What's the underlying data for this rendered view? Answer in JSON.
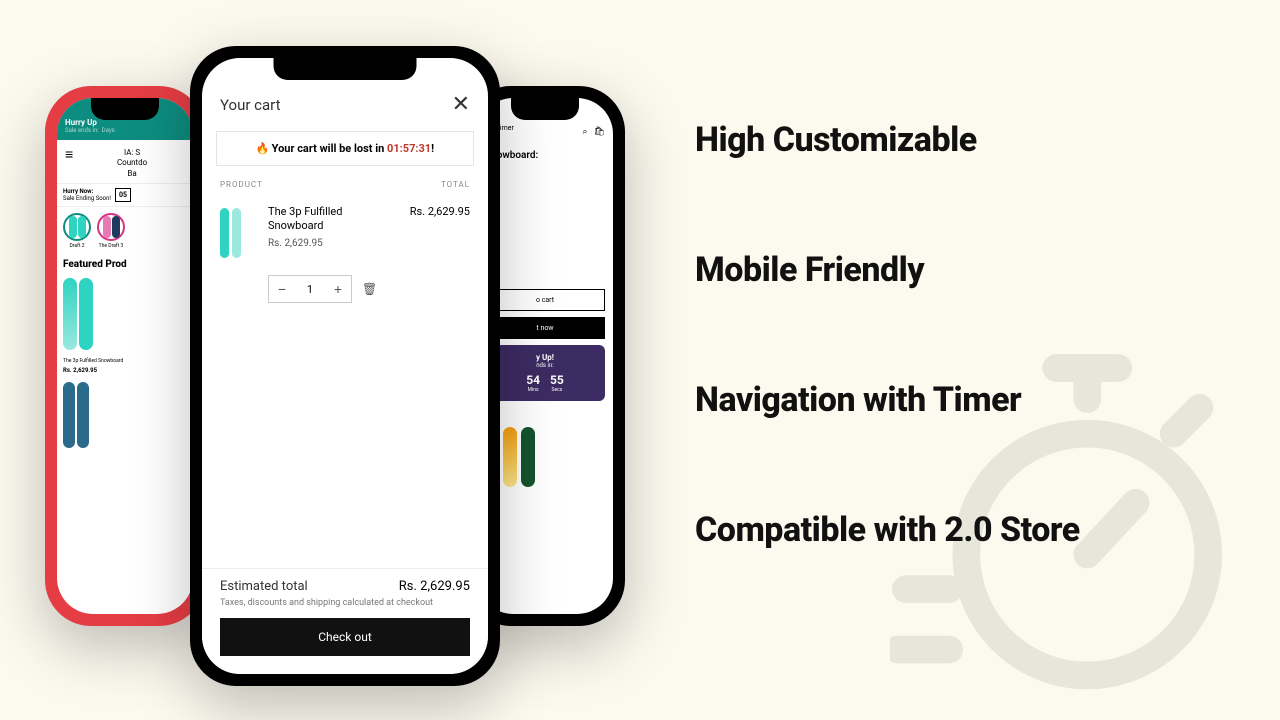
{
  "features": [
    "High Customizable",
    "Mobile Friendly",
    "Navigation with Timer",
    "Compatible with 2.0 Store"
  ],
  "left_phone": {
    "banner_title": "Hurry Up",
    "banner_sub": "Sale ends in:",
    "banner_unit": "Days",
    "page_title_1": "IA: S",
    "page_title_2": "Countdo",
    "page_title_3": "Ba",
    "hurry_title": "Hurry Now:",
    "hurry_sub": "Sale Ending Soon!",
    "hurry_box": "05",
    "draft1": "Draft 2",
    "draft2": "The Draft 3",
    "featured": "Featured Prod",
    "prod_name": "The 3p Fulfilled Snowboard",
    "prod_price": "Rs. 2,629.95"
  },
  "right_phone": {
    "header_text": "wn Timer",
    "header_sub": "ar",
    "title": "Snowboard:",
    "btn_cart": "o cart",
    "btn_now": "t now",
    "timer_t1": "y Up!",
    "timer_t2": "nds in:",
    "mins": "54",
    "secs": "55",
    "mins_lbl": "Mins",
    "secs_lbl": "Secs"
  },
  "center_phone": {
    "title": "Your cart",
    "banner_prefix": "Your cart will be lost in",
    "banner_time": "01:57:31",
    "col_product": "PRODUCT",
    "col_total": "TOTAL",
    "item_name": "The 3p Fulfilled Snowboard",
    "item_unit_price": "Rs. 2,629.95",
    "item_total": "Rs. 2,629.95",
    "qty": "1",
    "est_label": "Estimated total",
    "est_amount": "Rs. 2,629.95",
    "note": "Taxes, discounts and shipping calculated at checkout",
    "checkout": "Check out"
  }
}
